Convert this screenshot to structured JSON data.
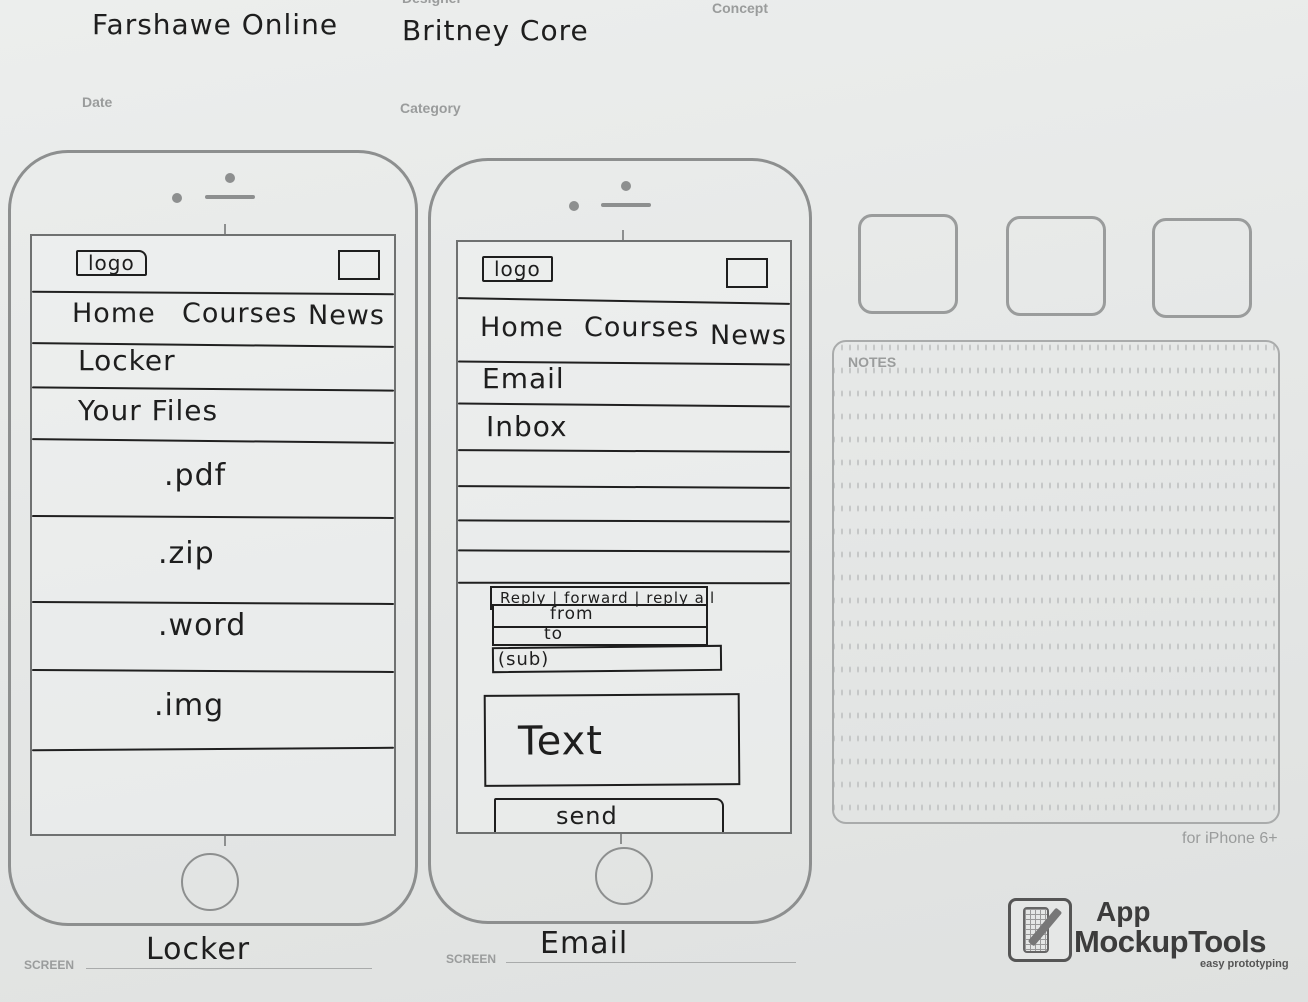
{
  "sheet": {
    "header": {
      "project_value": "Farshawe Online",
      "designer_label": "Designer",
      "designer_value": "Britney Core",
      "concept_label": "Concept",
      "date_label": "Date",
      "category_label": "Category"
    },
    "device_note": "for iPhone 6+",
    "notes_label": "NOTES",
    "screen_label": "SCREEN",
    "brand": {
      "name_top": "App",
      "name_main": "MockupTools",
      "tagline": "easy prototyping"
    }
  },
  "screens": [
    {
      "screen_name": "Locker",
      "logo_label": "logo",
      "nav": [
        "Home",
        "Courses",
        "News"
      ],
      "section_title": "Locker",
      "subsection_title": "Your Files",
      "files": [
        ".pdf",
        ".zip",
        ".word",
        ".img"
      ]
    },
    {
      "screen_name": "Email",
      "logo_label": "logo",
      "nav": [
        "Home",
        "Courses",
        "News"
      ],
      "section_title": "Email",
      "subsection_title": "Inbox",
      "compose": {
        "actions_label": "Reply | forward | reply all",
        "from_label": "from",
        "to_label": "to",
        "subject_label": "(sub)",
        "body_placeholder": "Text",
        "send_label": "send"
      }
    }
  ]
}
